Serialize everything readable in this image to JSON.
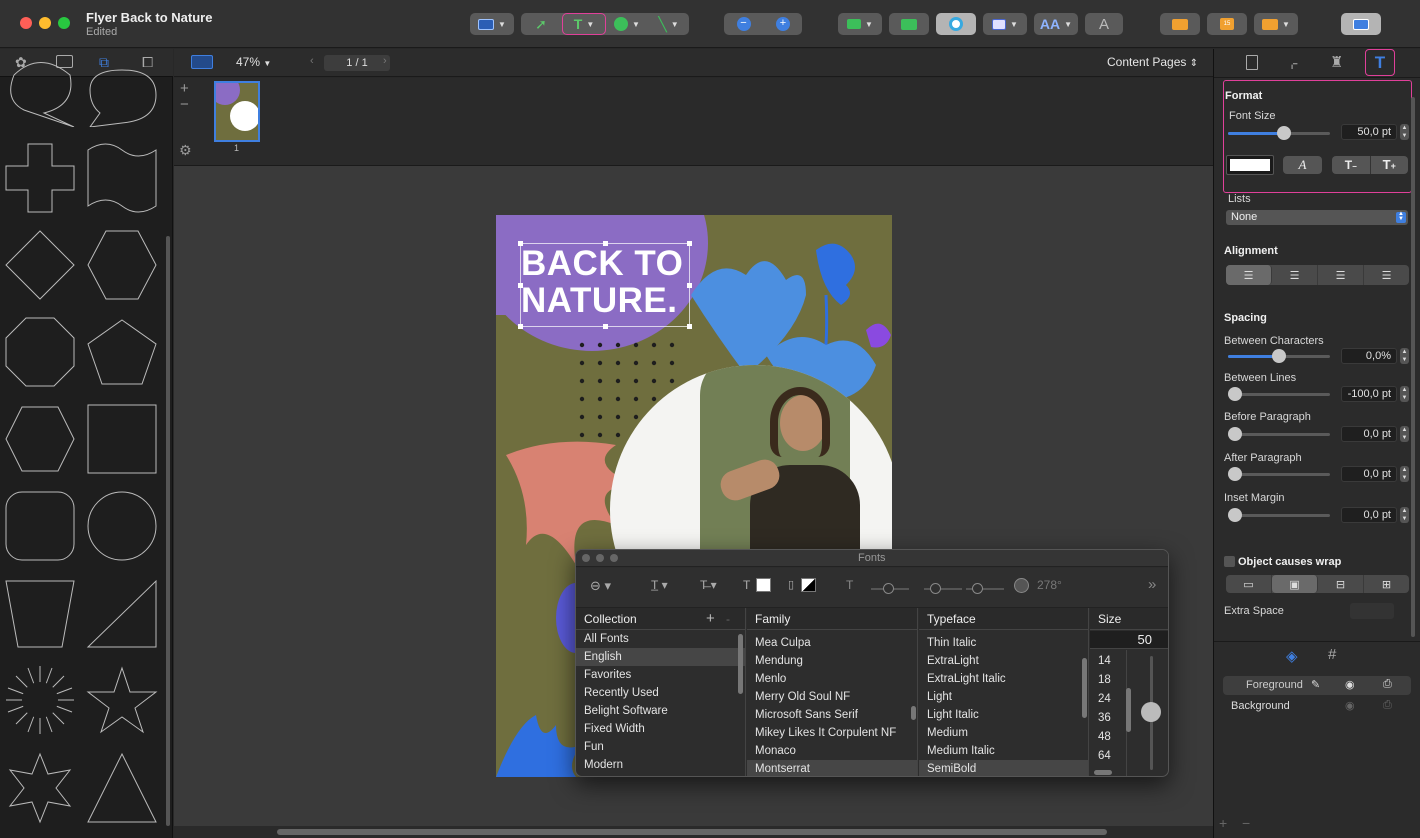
{
  "window": {
    "title": "Flyer Back to Nature",
    "subtitle": "Edited"
  },
  "toolbar": {
    "zoom": "47%",
    "page_indicator": "1 / 1",
    "content_pages": "Content Pages"
  },
  "thumbnail": {
    "page_number": "1"
  },
  "flyer": {
    "headline_line1": "BACK TO",
    "headline_line2": "NATURE."
  },
  "inspector": {
    "format_header": "Format",
    "font_size_label": "Font Size",
    "font_size_value": "50,0 pt",
    "font_size_fraction": 0.55,
    "lists_label": "Lists",
    "lists_value": "None",
    "alignment_header": "Alignment",
    "spacing_header": "Spacing",
    "between_characters_label": "Between Characters",
    "between_characters_value": "0,0%",
    "between_lines_label": "Between Lines",
    "between_lines_value": "-100,0 pt",
    "before_paragraph_label": "Before Paragraph",
    "before_paragraph_value": "0,0 pt",
    "after_paragraph_label": "After Paragraph",
    "after_paragraph_value": "0,0 pt",
    "inset_margin_label": "Inset Margin",
    "inset_margin_value": "0,0 pt",
    "wrap_label": "Object causes wrap",
    "extra_space_label": "Extra Space",
    "text_color": "#ffffff"
  },
  "layers": {
    "foreground": "Foreground",
    "background": "Background"
  },
  "fonts_panel": {
    "title": "Fonts",
    "angle": "278°",
    "collection_header": "Collection",
    "family_header": "Family",
    "typeface_header": "Typeface",
    "size_header": "Size",
    "size_value": "50",
    "collections": [
      "All Fonts",
      "English",
      "Favorites",
      "Recently Used",
      "Belight Software",
      "Fixed Width",
      "Fun",
      "Modern"
    ],
    "families": [
      "Mea Culpa",
      "Mendung",
      "Menlo",
      "Merry Old Soul NF",
      "Microsoft Sans Serif",
      "Mikey Likes It Corpulent NF",
      "Monaco",
      "Montserrat"
    ],
    "typefaces": [
      "Thin Italic",
      "ExtraLight",
      "ExtraLight Italic",
      "Light",
      "Light Italic",
      "Medium",
      "Medium Italic",
      "SemiBold"
    ],
    "sizes": [
      "14",
      "18",
      "24",
      "36",
      "48",
      "64"
    ]
  },
  "colors": {
    "accent": "#3f7fe0",
    "highlight": "#e0409a",
    "olive": "#6f6e3e",
    "purple": "#8b6cc4",
    "leaf_blue": "#4c8fe0",
    "coral": "#d88272"
  }
}
